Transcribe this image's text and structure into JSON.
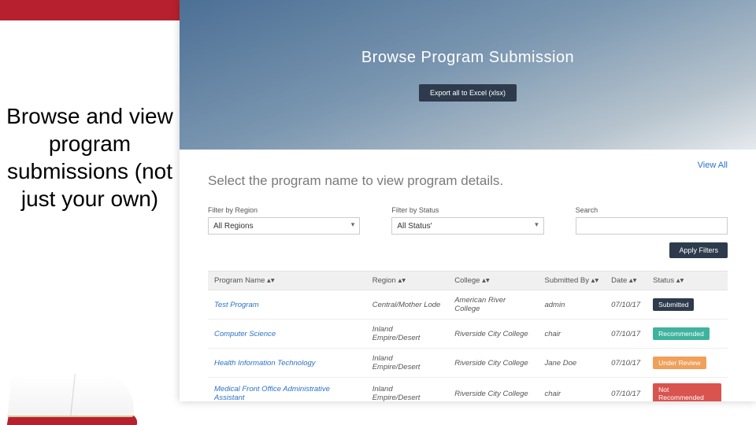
{
  "sidebar": {
    "caption": "Browse and view program submissions (not just your own)"
  },
  "hero": {
    "title": "Browse Program Submission",
    "export_label": "Export all to Excel (xlsx)"
  },
  "content": {
    "view_all": "View All",
    "instructions": "Select the program name to view program details.",
    "filters": {
      "region_label": "Filter by Region",
      "region_value": "All Regions",
      "status_label": "Filter by Status",
      "status_value": "All Status'",
      "search_label": "Search",
      "search_value": "",
      "apply_label": "Apply Filters"
    },
    "table": {
      "headers": {
        "program": "Program Name ▴▾",
        "region": "Region ▴▾",
        "college": "College ▴▾",
        "submitted_by": "Submitted By ▴▾",
        "date": "Date ▴▾",
        "status": "Status ▴▾"
      },
      "rows": [
        {
          "program": "Test Program",
          "region": "Central/Mother Lode",
          "college": "American River College",
          "submitted_by": "admin",
          "date": "07/10/17",
          "status": "Submitted",
          "status_kind": "sub"
        },
        {
          "program": "Computer Science",
          "region": "Inland Empire/Desert",
          "college": "Riverside City College",
          "submitted_by": "chair",
          "date": "07/10/17",
          "status": "Recommended",
          "status_kind": "rec"
        },
        {
          "program": "Health Information Technology",
          "region": "Inland Empire/Desert",
          "college": "Riverside City College",
          "submitted_by": "Jane Doe",
          "date": "07/10/17",
          "status": "Under Review",
          "status_kind": "rev"
        },
        {
          "program": "Medical Front Office Administrative Assistant",
          "region": "Inland Empire/Desert",
          "college": "Riverside City College",
          "submitted_by": "chair",
          "date": "07/10/17",
          "status": "Not Recommended",
          "status_kind": "not"
        }
      ]
    }
  }
}
